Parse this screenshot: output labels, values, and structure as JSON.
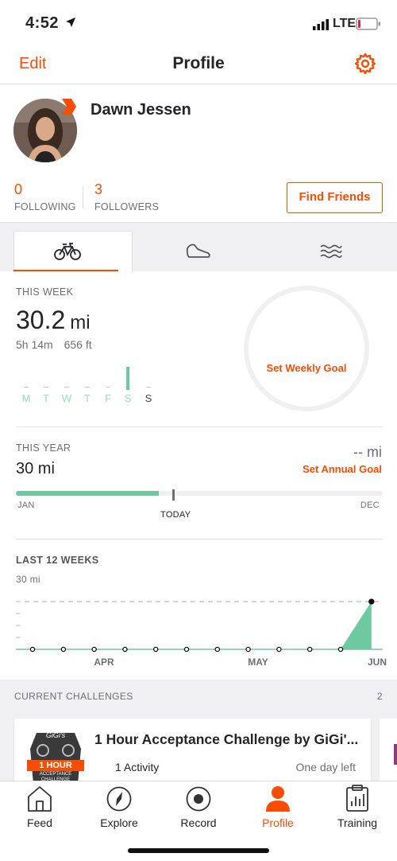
{
  "status_bar": {
    "time": "4:52",
    "network": "LTE"
  },
  "nav": {
    "edit": "Edit",
    "title": "Profile"
  },
  "profile": {
    "name": "Dawn Jessen",
    "following_count": "0",
    "following_label": "FOLLOWING",
    "followers_count": "3",
    "followers_label": "FOLLOWERS",
    "find_friends": "Find Friends"
  },
  "sport_tabs": {
    "active": "ride",
    "items": [
      "bike-icon",
      "shoe-icon",
      "water-icon"
    ]
  },
  "this_week": {
    "label": "THIS WEEK",
    "distance": "30.2",
    "unit": "mi",
    "time": "5h 14m",
    "elevation": "656 ft",
    "days": [
      "M",
      "T",
      "W",
      "T",
      "F",
      "S",
      "S"
    ],
    "active_day_index": 5,
    "goal_link": "Set Weekly Goal"
  },
  "this_year": {
    "label": "THIS YEAR",
    "distance": "30 mi",
    "goal_value": "-- mi",
    "goal_link": "Set Annual Goal",
    "start": "JAN",
    "end": "DEC",
    "today": "TODAY",
    "progress_fraction": 0.39
  },
  "last_12_weeks": {
    "label": "LAST 12 WEEKS",
    "max_label": "30 mi",
    "months": [
      "APR",
      "MAY",
      "JUN"
    ],
    "values": [
      0,
      0,
      0,
      0,
      0,
      0,
      0,
      0,
      0,
      0,
      0,
      30.2
    ]
  },
  "challenges": {
    "label": "CURRENT CHALLENGES",
    "count": "2",
    "badge_lines": [
      "GiGi's",
      "1 HOUR",
      "ACCEPTANCE",
      "CHALLENGE"
    ],
    "title": "1 Hour Acceptance Challenge by GiGi'...",
    "activity": "1 Activity",
    "time_left": "One day left"
  },
  "tab_bar": [
    {
      "label": "Feed",
      "icon": "home-icon"
    },
    {
      "label": "Explore",
      "icon": "compass-icon"
    },
    {
      "label": "Record",
      "icon": "record-icon"
    },
    {
      "label": "Profile",
      "icon": "person-icon",
      "active": true
    },
    {
      "label": "Training",
      "icon": "clipboard-chart-icon"
    }
  ],
  "colors": {
    "accent": "#fc4c02",
    "chart_green": "#6dc9a0",
    "text": "#242428",
    "muted": "#6d6d78"
  }
}
